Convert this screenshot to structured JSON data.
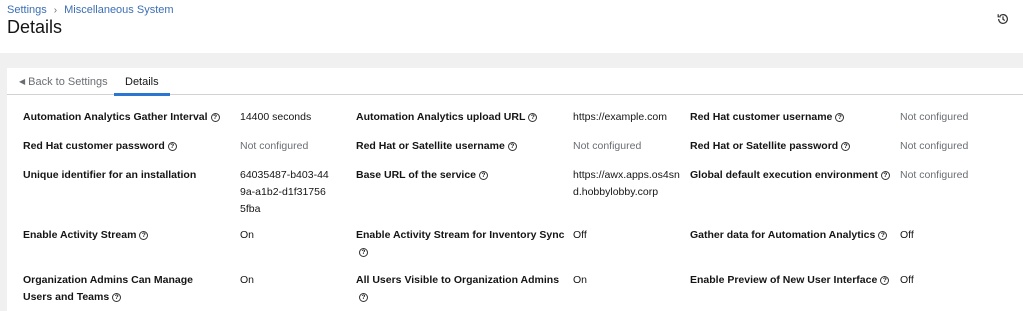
{
  "breadcrumb": {
    "items": [
      "Settings",
      "Miscellaneous System"
    ],
    "separator": "›"
  },
  "page": {
    "title": "Details"
  },
  "tabs": {
    "back_label": "Back to Settings",
    "active_label": "Details"
  },
  "details": [
    {
      "term": "Automation Analytics Gather Interval",
      "value": "14400 seconds"
    },
    {
      "term": "Automation Analytics upload URL",
      "value": "https://example.com"
    },
    {
      "term": "Red Hat customer username",
      "value": "Not configured"
    },
    {
      "term": "Red Hat customer password",
      "value": "Not configured"
    },
    {
      "term": "Red Hat or Satellite username",
      "value": "Not configured"
    },
    {
      "term": "Red Hat or Satellite password",
      "value": "Not configured"
    },
    {
      "term": "Unique identifier for an installation",
      "value": "64035487-b403-449a-a1b2-d1f317565fba"
    },
    {
      "term": "Base URL of the service",
      "value": "https://awx.apps.os4snd.hobbylobby.corp"
    },
    {
      "term": "Global default execution environment",
      "value": "Not configured"
    },
    {
      "term": "Enable Activity Stream",
      "value": "On"
    },
    {
      "term": "Enable Activity Stream for Inventory Sync",
      "value": "Off"
    },
    {
      "term": "Gather data for Automation Analytics",
      "value": "Off"
    },
    {
      "term": "Organization Admins Can Manage Users and Teams",
      "value": "On"
    },
    {
      "term": "All Users Visible to Organization Admins",
      "value": "On"
    },
    {
      "term": "Enable Preview of New User Interface",
      "value": "Off"
    }
  ],
  "colors": {
    "link": "#3c6fb4",
    "tab_active": "#2b76d0",
    "muted": "#6a6e73"
  }
}
